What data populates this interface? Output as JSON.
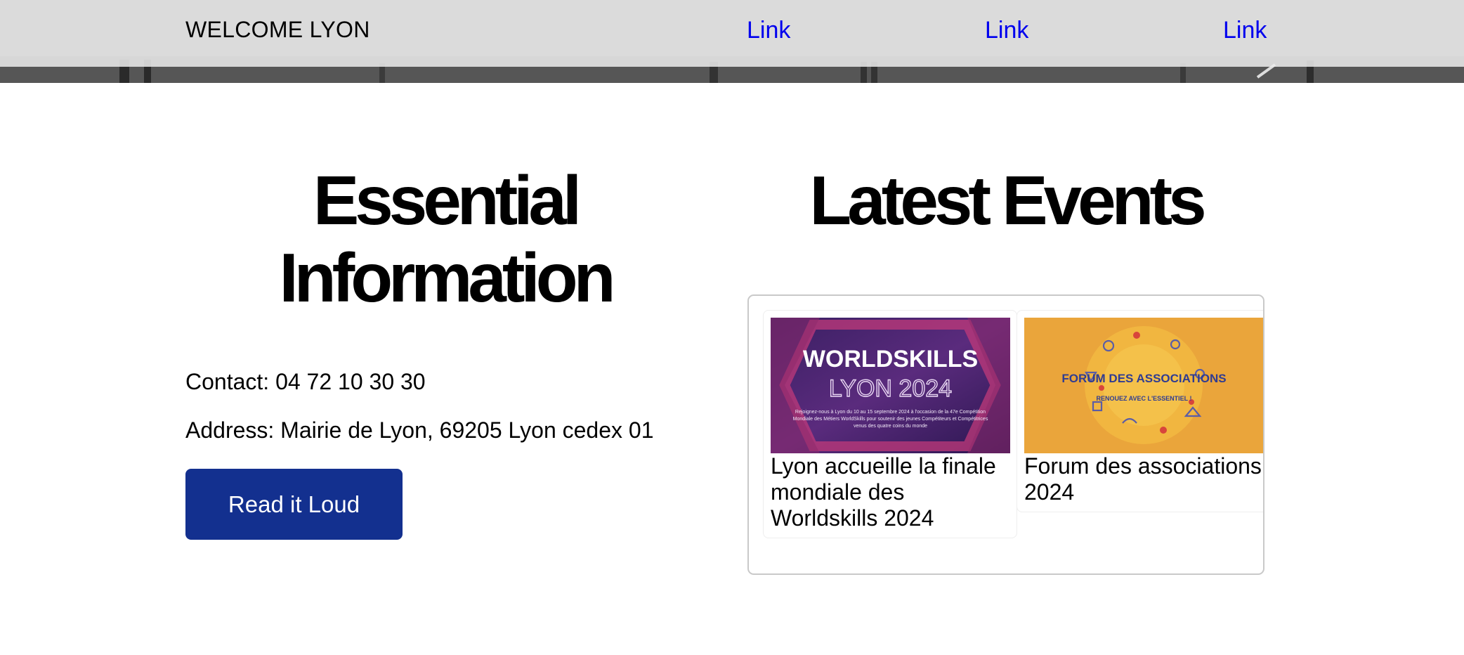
{
  "header": {
    "brand": "WELCOME LYON",
    "links": [
      "Link",
      "Link",
      "Link"
    ]
  },
  "essential": {
    "title": "Essential Information",
    "contact": "Contact: 04 72 10 30 30",
    "address": "Address: Mairie de Lyon, 69205 Lyon cedex 01",
    "button_label": "Read it Loud"
  },
  "events": {
    "title": "Latest Events",
    "items": [
      {
        "caption": "Lyon accueille la finale mondiale des Worldskills 2024",
        "thumb_title": "WORLDSKILLS",
        "thumb_subtitle": "LYON 2024",
        "thumb_text": "Rejoignez-nous à Lyon du 10 au 15 septembre 2024 à l'occasion de la 47e Compétition Mondiale des Métiers WorldSkills pour soutenir des jeunes Compétiteurs et Compétitrices venus des quatre coins du monde"
      },
      {
        "caption": "Forum des associations 2024",
        "thumb_title": "FORUM DES ASSOCIATIONS",
        "thumb_subtitle": "RENOUEZ AVEC L'ESSENTIEL !"
      }
    ]
  },
  "colors": {
    "button": "#13308f",
    "link": "#0000ee",
    "events_border": "#c9c9c9"
  }
}
